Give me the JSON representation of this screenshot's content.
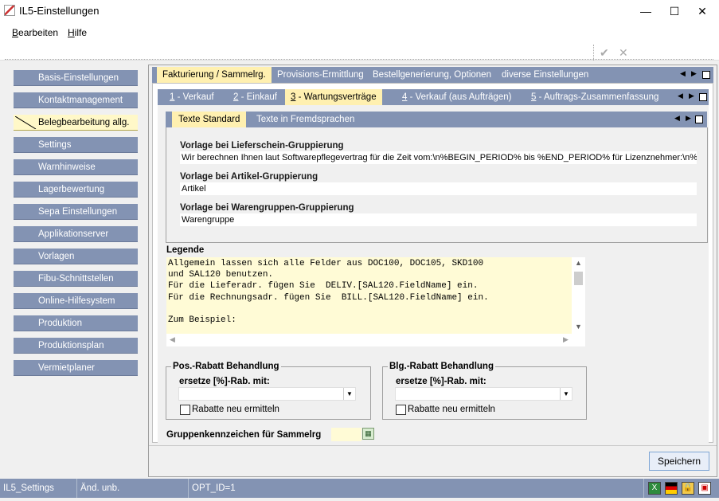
{
  "window": {
    "title": "IL5-Einstellungen",
    "minimize": "—",
    "maximize": "☐",
    "close": "✕"
  },
  "menu": {
    "items": [
      {
        "first": "B",
        "rest": "earbeiten"
      },
      {
        "first": "H",
        "rest": "ilfe"
      }
    ]
  },
  "toolbar": {
    "confirm": "✔",
    "cancel": "✕"
  },
  "sidebar": {
    "items": [
      {
        "label": "Basis-Einstellungen"
      },
      {
        "label": "Kontaktmanagement"
      },
      {
        "label": "Belegbearbeitung allg."
      },
      {
        "label": "Settings"
      },
      {
        "label": "Warnhinweise"
      },
      {
        "label": "Lagerbewertung"
      },
      {
        "label": "Sepa Einstellungen"
      },
      {
        "label": "Applikationserver"
      },
      {
        "label": "Vorlagen"
      },
      {
        "label": "Fibu-Schnittstellen"
      },
      {
        "label": "Online-Hilfesystem"
      },
      {
        "label": "Produktion"
      },
      {
        "label": "Produktionsplan"
      },
      {
        "label": "Vermietplaner"
      }
    ],
    "active_index": 2
  },
  "tabs_level1": [
    {
      "label": "Fakturierung / Sammelrg."
    },
    {
      "label": "Provisions-Ermittlung"
    },
    {
      "label": "Bestellgenerierung, Optionen"
    },
    {
      "label": "diverse Einstellungen"
    }
  ],
  "tabs_level2": [
    {
      "num": "1",
      "label": " - Verkauf"
    },
    {
      "num": "2",
      "label": " - Einkauf"
    },
    {
      "num": "3",
      "label": " - Wartungsverträge"
    },
    {
      "num": "4",
      "label": " - Verkauf (aus Aufträgen)"
    },
    {
      "num": "5",
      "label": " - Auftrags-Zusammenfassung"
    }
  ],
  "tabs_level3": [
    {
      "label": "Texte Standard"
    },
    {
      "label": "Texte in Fremdsprachen"
    }
  ],
  "nav": {
    "prev": "◀",
    "next": "▶"
  },
  "fields": {
    "lieferschein": {
      "label": "Vorlage bei Lieferschein-Gruppierung",
      "value": "Wir berechnen Ihnen laut Softwarepflegevertrag für die Zeit vom:\\n%BEGIN_PERIOD% bis %END_PERIOD%  für Lizenznehmer:\\n%N"
    },
    "artikel": {
      "label": "Vorlage bei Artikel-Gruppierung",
      "value": "Artikel"
    },
    "warengruppen": {
      "label": "Vorlage bei Warengruppen-Gruppierung",
      "value": "Warengruppe"
    }
  },
  "legende": {
    "label": "Legende",
    "text": "Allgemein lassen sich alle Felder aus DOC100, DOC105, SKD100\nund SAL120 benutzen.\nFür die Lieferadr. fügen Sie  DELIV.[SAL120.FieldName] ein.\nFür die Rechnungsadr. fügen Sie  BILL.[SAL120.FieldName] ein.\n\nZum Beispiel:"
  },
  "pos_rabatt": {
    "title": "Pos.-Rabatt Behandlung",
    "sub": "ersetze [%]-Rab.  mit:",
    "value": "",
    "checkbox": "Rabatte neu ermitteln"
  },
  "blg_rabatt": {
    "title": "Blg.-Rabatt Behandlung",
    "sub": "ersetze [%]-Rab.  mit:",
    "value": "",
    "checkbox": "Rabatte neu ermitteln"
  },
  "gruppenkennzeichen": {
    "label": "Gruppenkennzeichen für Sammelrg",
    "value": ""
  },
  "save_label": "Speichern",
  "status": {
    "cell1": "IL5_Settings",
    "cell2": "Änd. unb.",
    "cell3": "OPT_ID=1"
  }
}
